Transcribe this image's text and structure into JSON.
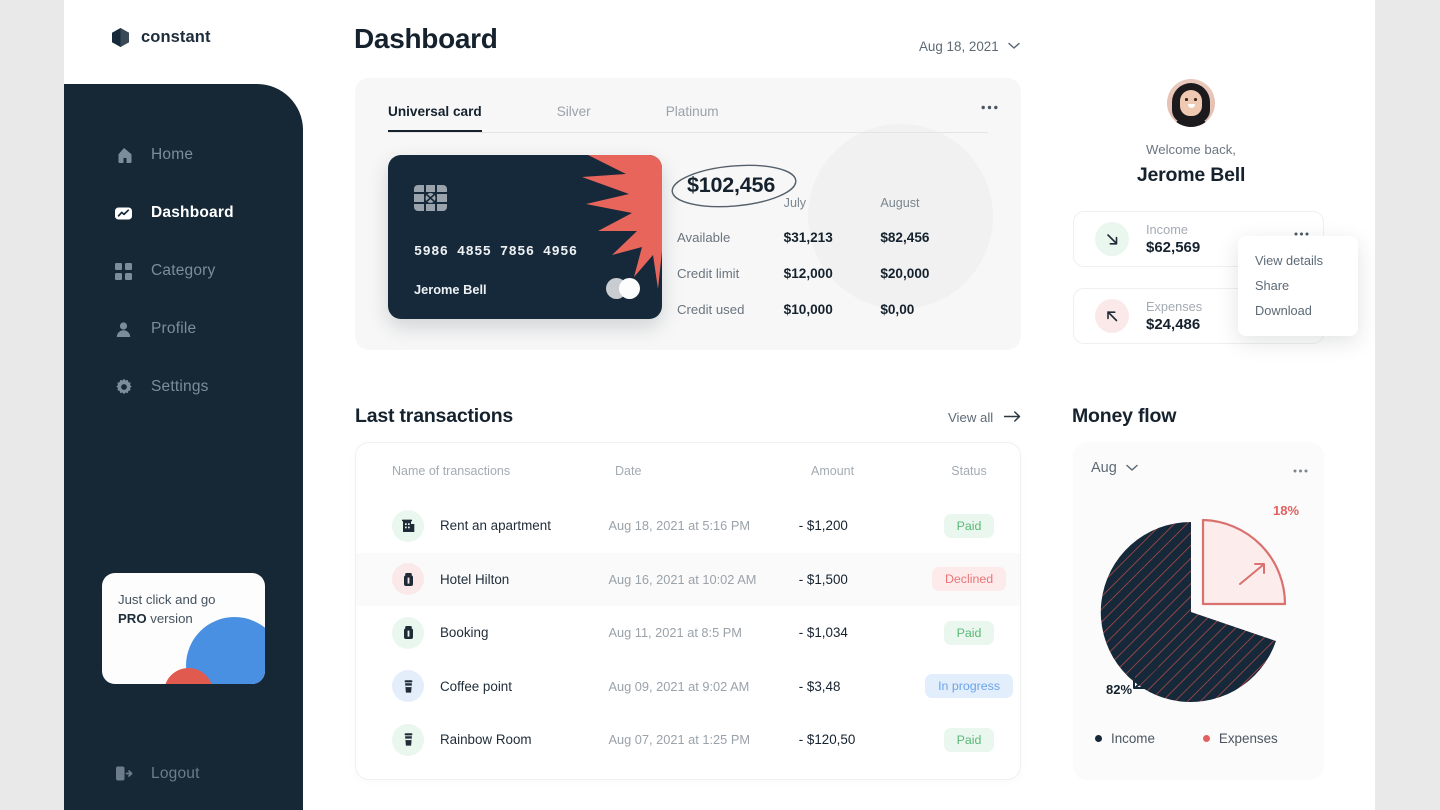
{
  "brand": {
    "name": "constant",
    "logo_icon": "hexagon-cube-icon"
  },
  "sidebar": {
    "items": [
      {
        "label": "Home",
        "icon": "home-icon",
        "active": false
      },
      {
        "label": "Dashboard",
        "icon": "dashboard-icon",
        "active": true
      },
      {
        "label": "Category",
        "icon": "grid-icon",
        "active": false
      },
      {
        "label": "Profile",
        "icon": "user-icon",
        "active": false
      },
      {
        "label": "Settings",
        "icon": "gear-icon",
        "active": false
      }
    ],
    "promo": {
      "line1": "Just click and go",
      "bold": "PRO",
      "line2": " version"
    },
    "logout": {
      "label": "Logout",
      "icon": "logout-icon"
    }
  },
  "header": {
    "title": "Dashboard",
    "date": "Aug 18, 2021",
    "chevron_icon": "chevron-down-icon"
  },
  "cards_panel": {
    "tabs": [
      {
        "label": "Universal card",
        "active": true
      },
      {
        "label": "Silver",
        "active": false
      },
      {
        "label": "Platinum",
        "active": false
      }
    ],
    "more_icon": "ellipsis-icon",
    "credit_card": {
      "number": "5986  4855 7856  4956",
      "holder": "Jerome Bell",
      "chip_icon": "card-chip-icon",
      "network_icon": "mastercard-icon"
    },
    "balance": "$102,456",
    "columns": [
      "July",
      "August"
    ],
    "rows": [
      {
        "label": "Available",
        "july": "$31,213",
        "august": "$82,456"
      },
      {
        "label": "Credit limit",
        "july": "$12,000",
        "august": "$20,000"
      },
      {
        "label": "Credit used",
        "july": "$10,000",
        "august": "$0,00"
      }
    ]
  },
  "transactions": {
    "title": "Last transactions",
    "view_all": "View all",
    "arrow_icon": "arrow-right-icon",
    "columns": [
      "Name of transactions",
      "Date",
      "Amount",
      "Status"
    ],
    "rows": [
      {
        "name": "Rent an apartment",
        "date": "Aug 18, 2021 at 5:16 PM",
        "amount": "- $1,200",
        "status": "Paid",
        "status_kind": "paid",
        "icon": "building-icon",
        "icon_tint": "green"
      },
      {
        "name": "Hotel Hilton",
        "date": "Aug 16, 2021 at 10:02 AM",
        "amount": "- $1,500",
        "status": "Declined",
        "status_kind": "declined",
        "icon": "suitcase-icon",
        "icon_tint": "pink"
      },
      {
        "name": "Booking",
        "date": "Aug 11, 2021 at 8:5 PM",
        "amount": "- $1,034",
        "status": "Paid",
        "status_kind": "paid",
        "icon": "suitcase-icon",
        "icon_tint": "green"
      },
      {
        "name": "Coffee point",
        "date": "Aug 09, 2021 at 9:02 AM",
        "amount": "- $3,48",
        "status": "In progress",
        "status_kind": "progress",
        "icon": "coffee-cup-icon",
        "icon_tint": "blue"
      },
      {
        "name": "Rainbow Room",
        "date": "Aug 07, 2021 at 1:25 PM",
        "amount": "- $120,50",
        "status": "Paid",
        "status_kind": "paid",
        "icon": "coffee-cup-icon",
        "icon_tint": "green"
      }
    ]
  },
  "profile": {
    "welcome": "Welcome back,",
    "name": "Jerome Bell",
    "avatar_icon": "avatar"
  },
  "kpis": [
    {
      "label": "Income",
      "value": "$62,569",
      "icon": "arrow-down-right-icon",
      "tint": "green"
    },
    {
      "label": "Expenses",
      "value": "$24,486",
      "icon": "arrow-up-left-icon",
      "tint": "pink"
    }
  ],
  "kpi_menu": {
    "items": [
      "View details",
      "Share",
      "Download"
    ]
  },
  "money_flow": {
    "title": "Money flow",
    "period": "Aug",
    "chevron_icon": "chevron-down-icon",
    "more_icon": "ellipsis-icon"
  },
  "chart_data": {
    "type": "pie",
    "title": "Money flow",
    "period": "Aug",
    "labels": [
      "Income",
      "Expenses"
    ],
    "values": [
      82,
      18
    ],
    "value_labels": [
      "82%",
      "18%"
    ],
    "colors": [
      "#16293a",
      "#fdecec"
    ],
    "legend_colors": [
      "#16293a",
      "#e0615f"
    ],
    "legend_position": "bottom",
    "annotations": [
      {
        "text": "18%",
        "points_to": "Expenses",
        "arrow": "arrow-up-right-icon"
      },
      {
        "text": "82%",
        "points_to": "Income",
        "arrow": "arrow-down-left-icon"
      }
    ]
  },
  "colors": {
    "sidebar": "#16293a",
    "accent_red": "#e0615f",
    "accent_blue": "#4a90e2",
    "paid_green": "#5bb878",
    "declined_red": "#e8767a",
    "progress_blue": "#6ba3e8"
  }
}
